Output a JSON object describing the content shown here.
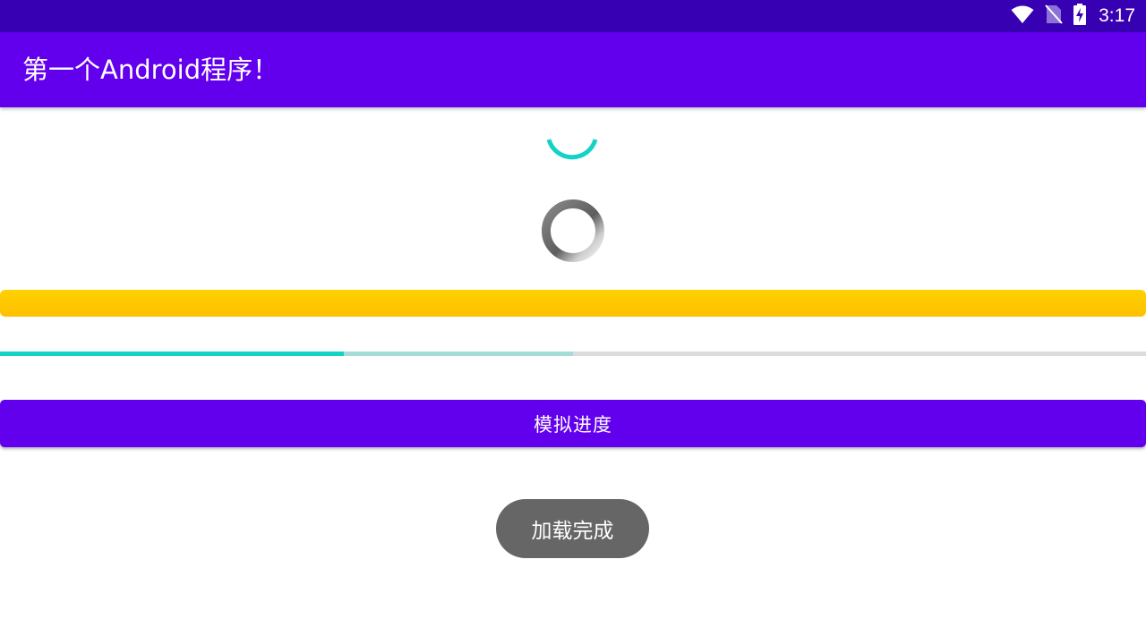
{
  "status_bar": {
    "time": "3:17",
    "icons": [
      "wifi-icon",
      "no-sim-icon",
      "battery-charging-icon"
    ],
    "color": "#3700b3"
  },
  "app_bar": {
    "title": "第一个Android程序！",
    "color": "#6200ee"
  },
  "spinners": {
    "teal_color": "#14d2c6",
    "gray_color": "#6e6e6e"
  },
  "progress_bars": {
    "yellow_bar_color": "#ffc400",
    "primary_progress": 0.3,
    "secondary_progress": 0.5,
    "primary_color": "#14d2c6",
    "secondary_color": "#a6dcd6",
    "track_color": "#dcdcdc"
  },
  "main": {
    "simulate_button_label": "模拟进度"
  },
  "toast": {
    "message": "加载完成"
  }
}
